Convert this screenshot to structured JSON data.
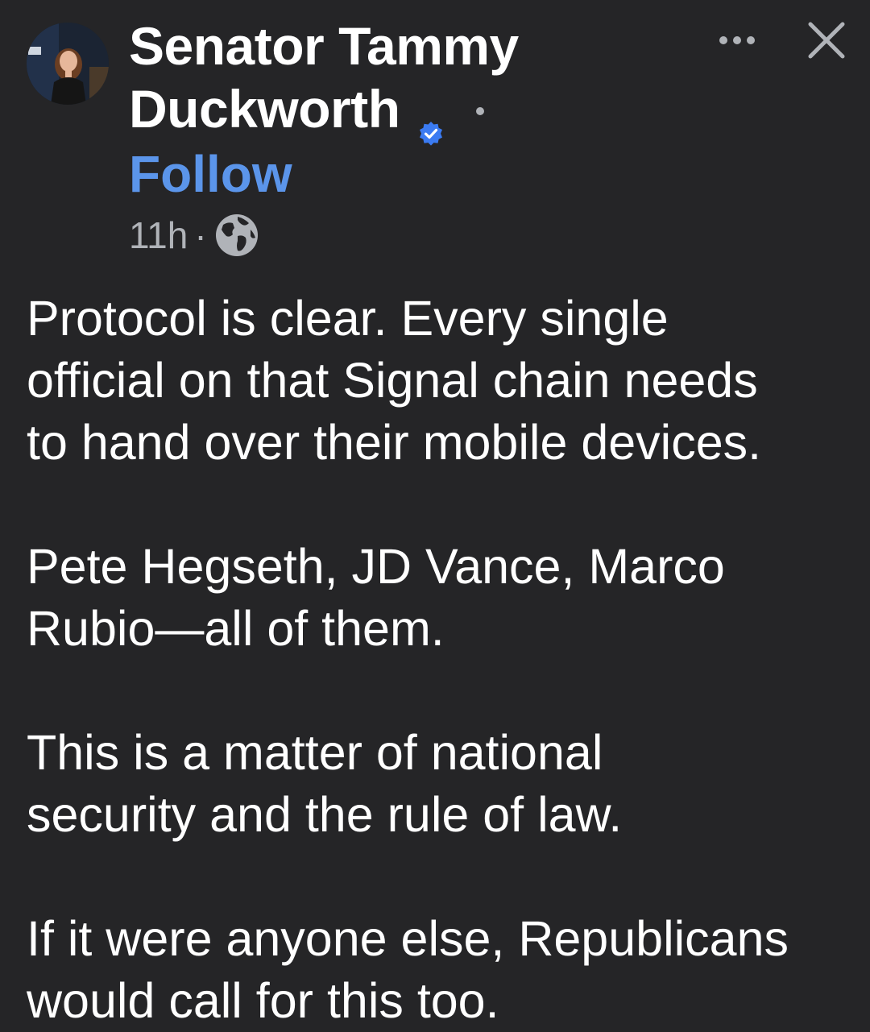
{
  "post": {
    "author": {
      "name_line1": "Senator Tammy",
      "name_line2": "Duckworth",
      "follow_label": "Follow",
      "verified": true,
      "avatar_icon": "person-photo"
    },
    "meta": {
      "timestamp": "11h",
      "separator": "·",
      "audience_icon": "globe-icon"
    },
    "actions": {
      "more_icon": "more-options-icon",
      "close_icon": "close-icon"
    },
    "body": {
      "paragraphs": [
        {
          "lines": [
            "Protocol is clear. Every single",
            "official on that Signal chain needs",
            "to hand over their mobile devices."
          ]
        },
        {
          "lines": [
            "Pete Hegseth, JD Vance, Marco",
            "Rubio—all of them."
          ]
        },
        {
          "lines": [
            "This is a matter of national",
            "security and the rule of law."
          ]
        },
        {
          "lines": [
            "If it were anyone else, Republicans",
            "would call for this too."
          ]
        }
      ]
    }
  },
  "colors": {
    "background": "#252527",
    "text": "#ffffff",
    "secondary_text": "#b0b3b8",
    "follow_link": "#5b95ea",
    "verified_badge": "#3b7bf2"
  }
}
